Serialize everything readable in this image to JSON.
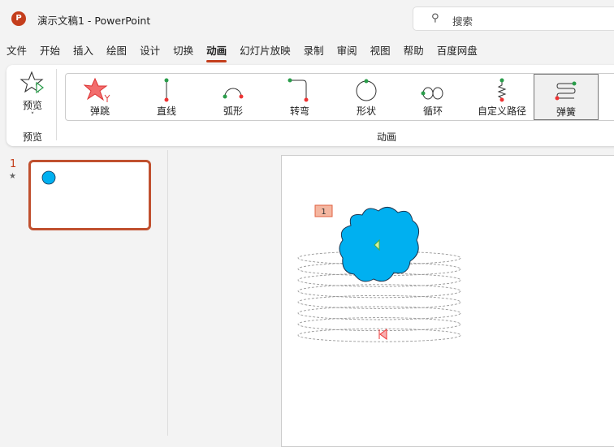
{
  "titlebar": {
    "logo": "P",
    "title": "演示文稿1  -  PowerPoint",
    "search_placeholder": "搜索"
  },
  "tabs": [
    "文件",
    "开始",
    "插入",
    "绘图",
    "设计",
    "切换",
    "动画",
    "幻灯片放映",
    "录制",
    "审阅",
    "视图",
    "帮助",
    "百度网盘"
  ],
  "active_tab": "动画",
  "ribbon": {
    "preview_label": "预览",
    "preview_group": "预览",
    "animation_group": "动画",
    "paths": [
      {
        "label": "弹跳",
        "icon": "bounce-star-icon"
      },
      {
        "label": "直线",
        "icon": "line-path-icon"
      },
      {
        "label": "弧形",
        "icon": "arc-path-icon"
      },
      {
        "label": "转弯",
        "icon": "turn-path-icon"
      },
      {
        "label": "形状",
        "icon": "shape-path-icon"
      },
      {
        "label": "循环",
        "icon": "loop-path-icon"
      },
      {
        "label": "自定义路径",
        "icon": "custom-path-icon"
      },
      {
        "label": "弹簧",
        "icon": "spring-path-icon",
        "selected": true
      }
    ]
  },
  "slides": [
    {
      "number": "1",
      "has_animation": true
    }
  ],
  "canvas": {
    "animation_tag": "1",
    "colors": {
      "cloud": "#00b0f0",
      "tag": "#f4b6a0",
      "accent": "#c43e1c"
    }
  }
}
